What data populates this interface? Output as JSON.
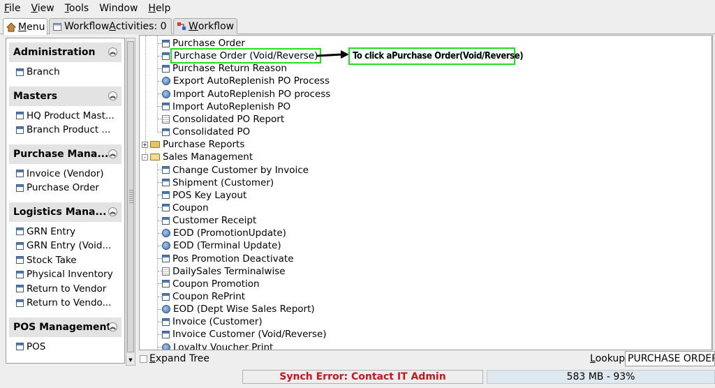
{
  "menubar": [
    {
      "pre": "",
      "u": "F",
      "post": "ile"
    },
    {
      "pre": "",
      "u": "V",
      "post": "iew"
    },
    {
      "pre": "",
      "u": "T",
      "post": "ools"
    },
    {
      "pre": "",
      "u": "",
      "post": "Window"
    },
    {
      "pre": "",
      "u": "H",
      "post": "elp"
    }
  ],
  "tabs": {
    "menu": {
      "u": "M",
      "post": "enu"
    },
    "activities": {
      "pre": "Workflow ",
      "u": "A",
      "post": "ctivities: 0"
    },
    "workflow": {
      "u": "W",
      "post": "orkflow"
    }
  },
  "sidebar": {
    "groups": [
      {
        "title": "Administration",
        "items": [
          "Branch"
        ]
      },
      {
        "title": "Masters",
        "items": [
          "HQ Product Mast...",
          "Branch Product ..."
        ]
      },
      {
        "title": "Purchase Mana...",
        "items": [
          "Invoice (Vendor)",
          "Purchase Order"
        ]
      },
      {
        "title": "Logistics Mana...",
        "items": [
          "GRN Entry",
          "GRN Entry (Void...",
          "Stock Take",
          "Physical Inventory",
          "Return to Vendor",
          "Return to Vendo..."
        ]
      },
      {
        "title": "POS Management",
        "items": [
          "POS"
        ]
      }
    ]
  },
  "tree": {
    "rows": [
      {
        "label": "Purchase Order",
        "icon": "form-icon",
        "level": 2
      },
      {
        "label": "Purchase Order (Void/Reverse)",
        "icon": "form-icon",
        "level": 2,
        "highlight": true
      },
      {
        "label": "Purchase Return Reason",
        "icon": "form-icon",
        "level": 2
      },
      {
        "label": "Export AutoReplenish PO Process",
        "icon": "gear-icon",
        "level": 2
      },
      {
        "label": "Import AutoReplenish PO process",
        "icon": "gear-icon",
        "level": 2
      },
      {
        "label": "Import AutoReplenish PO",
        "icon": "form-icon",
        "level": 2
      },
      {
        "label": "Consolidated PO Report",
        "icon": "report-icon",
        "level": 2
      },
      {
        "label": "Consolidated PO",
        "icon": "form-icon",
        "level": 2
      },
      {
        "label": "Purchase Reports",
        "icon": "folder-icon",
        "level": 1,
        "expander": "+"
      },
      {
        "label": "Sales Management",
        "icon": "folder-open-icon",
        "level": 1,
        "expander": "-"
      },
      {
        "label": "Change Customer by Invoice",
        "icon": "form-icon",
        "level": 2
      },
      {
        "label": "Shipment (Customer)",
        "icon": "form-icon",
        "level": 2
      },
      {
        "label": "POS Key Layout",
        "icon": "form-icon",
        "level": 2
      },
      {
        "label": "Coupon",
        "icon": "form-icon",
        "level": 2
      },
      {
        "label": "Customer Receipt",
        "icon": "form-icon",
        "level": 2
      },
      {
        "label": "EOD (PromotionUpdate)",
        "icon": "gear-icon",
        "level": 2
      },
      {
        "label": "EOD (Terminal Update)",
        "icon": "gear-icon",
        "level": 2
      },
      {
        "label": "Pos Promotion Deactivate",
        "icon": "form-icon",
        "level": 2
      },
      {
        "label": "DailySales Terminalwise",
        "icon": "report-icon",
        "level": 2
      },
      {
        "label": "Coupon Promotion",
        "icon": "form-icon",
        "level": 2
      },
      {
        "label": "Coupon RePrint",
        "icon": "form-icon",
        "level": 2
      },
      {
        "label": "EOD (Dept Wise Sales Report)",
        "icon": "gear-icon",
        "level": 2
      },
      {
        "label": "Invoice (Customer)",
        "icon": "form-icon",
        "level": 2
      },
      {
        "label": "Invoice Customer (Void/Reverse)",
        "icon": "form-icon",
        "level": 2
      },
      {
        "label": "Loyalty Voucher Print",
        "icon": "gear-icon",
        "level": 2
      }
    ]
  },
  "annotation": {
    "text": "To click aPurchase Order(Void/Reverse)",
    "color": "#22dd22"
  },
  "bottom": {
    "expand_tree": {
      "u": "E",
      "post": "xpand Tree"
    },
    "lookup_label": {
      "u": "L",
      "post": "ookup"
    },
    "lookup_value": "PURCHASE ORDER"
  },
  "status": {
    "error": "Synch Error: Contact IT Admin",
    "memory": "583 MB - 93%",
    "error_color": "#c8161d"
  }
}
